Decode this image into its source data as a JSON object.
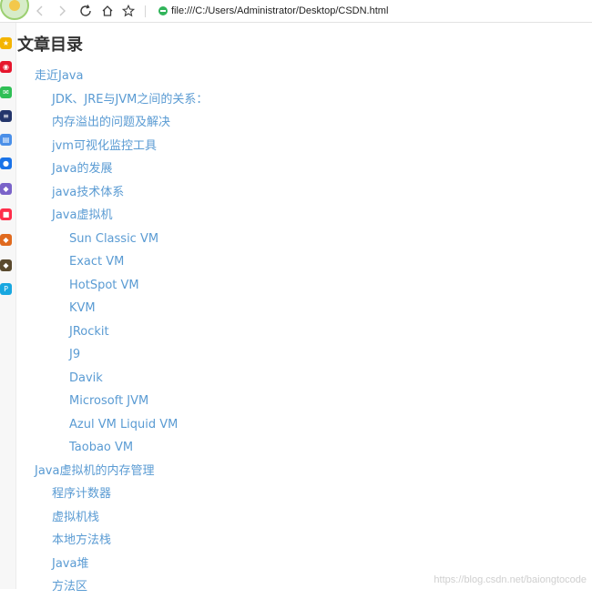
{
  "browser": {
    "url": "file:///C:/Users/Administrator/Desktop/CSDN.html",
    "icons": [
      "browser-logo-icon",
      "back-icon",
      "forward-icon",
      "reload-icon",
      "home-icon",
      "bookmark-star-icon",
      "secure-icon"
    ]
  },
  "sidebar": {
    "items": [
      {
        "name": "favorites-star-icon",
        "color": "#f4b400",
        "glyph": "★"
      },
      {
        "name": "weibo-icon",
        "color": "#e6162d",
        "glyph": "◉"
      },
      {
        "name": "mail-icon",
        "color": "#2fbf55",
        "glyph": "✉"
      },
      {
        "name": "news-app-icon",
        "color": "#23356b",
        "glyph": "≡"
      },
      {
        "name": "docs-icon",
        "color": "#4a8fe8",
        "glyph": "▤"
      },
      {
        "name": "chat-icon",
        "color": "#1a73e8",
        "glyph": "●"
      },
      {
        "name": "game-icon",
        "color": "#7a63c9",
        "glyph": "◆"
      },
      {
        "name": "shopping-icon",
        "color": "#ff2d4a",
        "glyph": "■"
      },
      {
        "name": "game-app-icon",
        "color": "#e06a1f",
        "glyph": "◆"
      },
      {
        "name": "game-app-2-icon",
        "color": "#5a4a2e",
        "glyph": "◆"
      },
      {
        "name": "pp-app-icon",
        "color": "#18a7e0",
        "glyph": "P"
      }
    ]
  },
  "page": {
    "title": "文章目录",
    "link_color": "#5a9bd3",
    "toc": [
      {
        "level": 1,
        "text": "走近Java"
      },
      {
        "level": 2,
        "text": "JDK、JRE与JVM之间的关系："
      },
      {
        "level": 2,
        "text": "内存溢出的问题及解决"
      },
      {
        "level": 2,
        "text": "jvm可视化监控工具"
      },
      {
        "level": 2,
        "text": "Java的发展"
      },
      {
        "level": 2,
        "text": "java技术体系"
      },
      {
        "level": 2,
        "text": "Java虚拟机"
      },
      {
        "level": 3,
        "text": "Sun Classic VM"
      },
      {
        "level": 3,
        "text": "Exact VM"
      },
      {
        "level": 3,
        "text": "HotSpot VM"
      },
      {
        "level": 3,
        "text": "KVM"
      },
      {
        "level": 3,
        "text": "JRockit"
      },
      {
        "level": 3,
        "text": "J9"
      },
      {
        "level": 3,
        "text": "Davik"
      },
      {
        "level": 3,
        "text": "Microsoft JVM"
      },
      {
        "level": 3,
        "text": "Azul VM Liquid VM"
      },
      {
        "level": 3,
        "text": "Taobao VM"
      },
      {
        "level": 1,
        "text": "Java虚拟机的内存管理"
      },
      {
        "level": 2,
        "text": "程序计数器"
      },
      {
        "level": 2,
        "text": "虚拟机栈"
      },
      {
        "level": 2,
        "text": "本地方法栈"
      },
      {
        "level": 2,
        "text": "Java堆"
      },
      {
        "level": 2,
        "text": "方法区"
      }
    ],
    "watermark": "https://blog.csdn.net/baiongtocode"
  }
}
